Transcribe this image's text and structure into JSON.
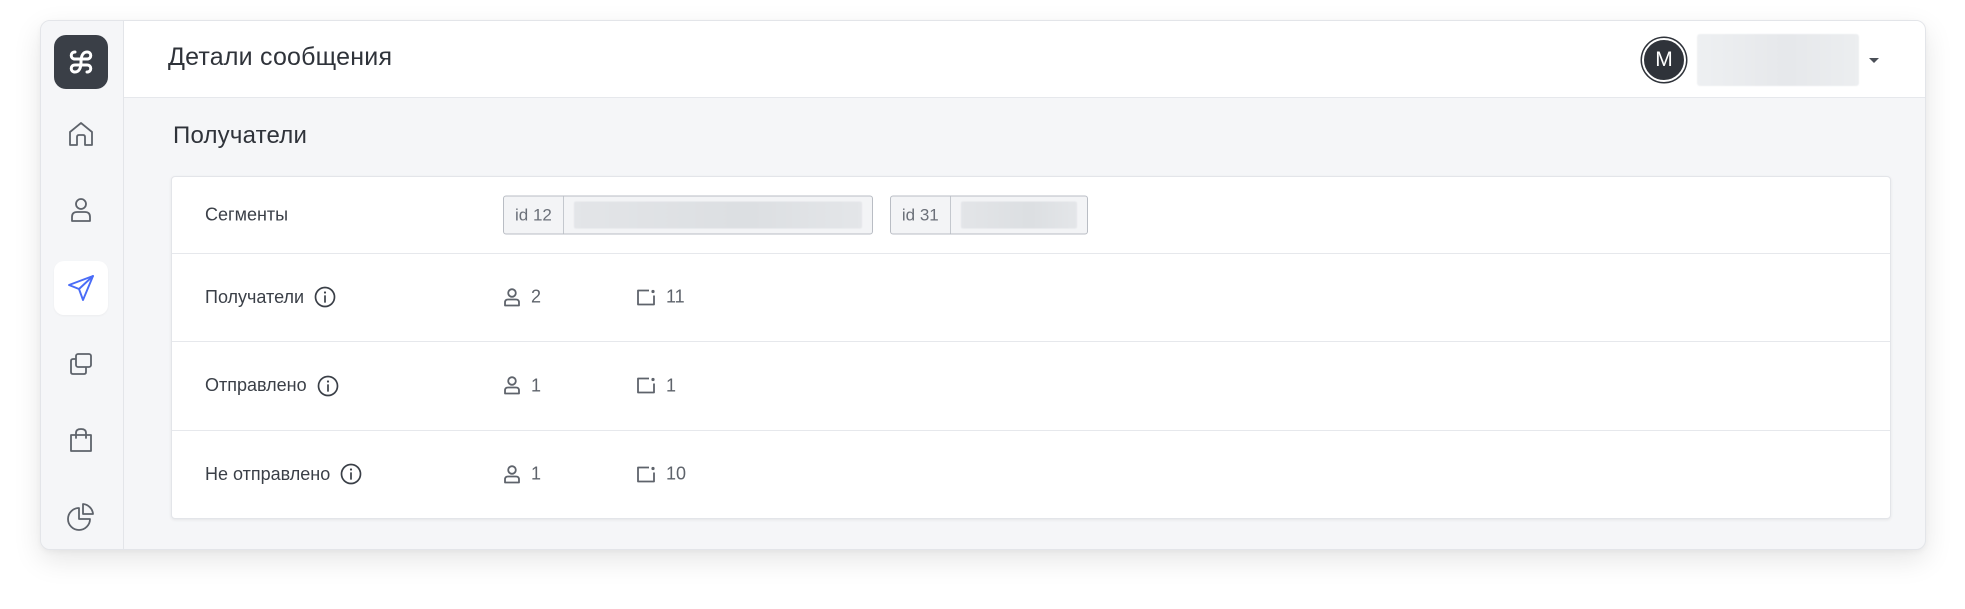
{
  "header": {
    "title": "Детали сообщения",
    "user_initial": "M"
  },
  "sidebar": {
    "items": [
      {
        "icon": "home-icon"
      },
      {
        "icon": "user-icon"
      },
      {
        "icon": "send-icon",
        "active": true
      },
      {
        "icon": "templates-icon"
      },
      {
        "icon": "shopping-bag-icon"
      },
      {
        "icon": "pie-chart-icon"
      }
    ]
  },
  "section": {
    "title": "Получатели"
  },
  "rows": {
    "segments": {
      "label": "Сегменты",
      "tags": [
        {
          "id": "id 12"
        },
        {
          "id": "id 31"
        }
      ]
    },
    "recipients": {
      "label": "Получатели",
      "users": "2",
      "devices": "11"
    },
    "sent": {
      "label": "Отправлено",
      "users": "1",
      "devices": "1"
    },
    "not_sent": {
      "label": "Не отправлено",
      "users": "1",
      "devices": "10"
    }
  },
  "colors": {
    "accent": "#4a6cf7",
    "icon": "#5e636b",
    "logo_bg": "#3a3f47"
  }
}
